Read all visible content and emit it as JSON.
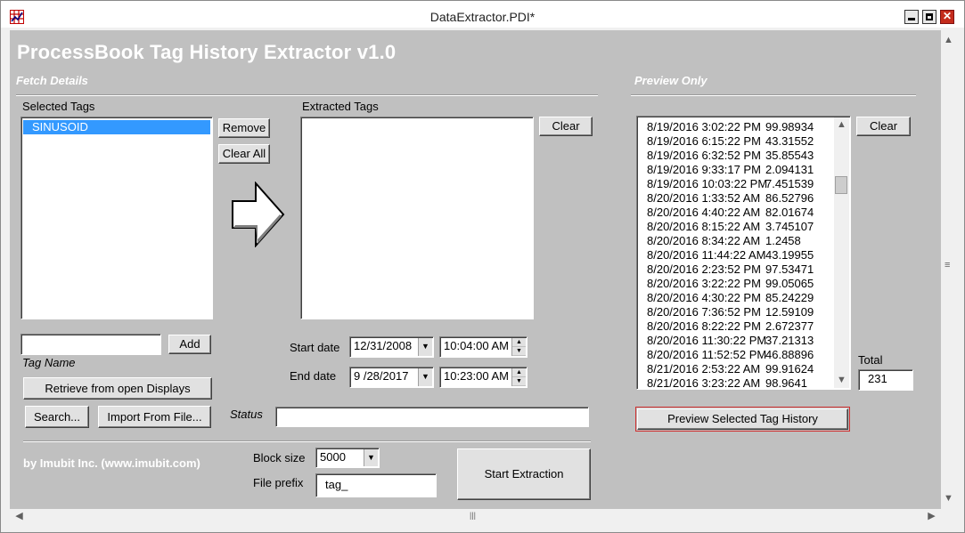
{
  "window": {
    "title": "DataExtractor.PDI*",
    "close_glyph": "✕"
  },
  "header": {
    "title": "ProcessBook Tag History Extractor v1.0"
  },
  "sections": {
    "fetch": "Fetch Details",
    "preview": "Preview Only"
  },
  "selected_tags": {
    "label": "Selected Tags",
    "items": [
      "SINUSOID"
    ],
    "remove_button": "Remove",
    "clear_all_button": "Clear All"
  },
  "extracted_tags": {
    "label": "Extracted Tags",
    "clear_button": "Clear"
  },
  "tag_input": {
    "value": "",
    "add_button": "Add",
    "label": "Tag Name"
  },
  "buttons": {
    "retrieve": "Retrieve from open Displays",
    "search": "Search...",
    "import": "Import From File...",
    "start": "Start Extraction",
    "preview": "Preview Selected Tag History",
    "preview_clear": "Clear"
  },
  "dates": {
    "start_label": "Start date",
    "start_date": "12/31/2008",
    "start_time": "10:04:00 AM",
    "end_label": "End date",
    "end_date": "9 /28/2017",
    "end_time": "10:23:00 AM"
  },
  "status": {
    "label": "Status",
    "value": ""
  },
  "footer": {
    "credit": "by Imubit Inc. (www.imubit.com)",
    "block_size_label": "Block size",
    "block_size": "5000",
    "file_prefix_label": "File prefix",
    "file_prefix": "tag_"
  },
  "preview": {
    "total_label": "Total",
    "total": "231",
    "rows": [
      [
        "8/19/2016 3:02:22 PM",
        "99.98934"
      ],
      [
        "8/19/2016 6:15:22 PM",
        "43.31552"
      ],
      [
        "8/19/2016 6:32:52 PM",
        "35.85543"
      ],
      [
        "8/19/2016 9:33:17 PM",
        "2.094131"
      ],
      [
        "8/19/2016 10:03:22 PM",
        "7.451539"
      ],
      [
        "8/20/2016 1:33:52 AM",
        "86.52796"
      ],
      [
        "8/20/2016 4:40:22 AM",
        "82.01674"
      ],
      [
        "8/20/2016 8:15:22 AM",
        "3.745107"
      ],
      [
        "8/20/2016 8:34:22 AM",
        "1.2458"
      ],
      [
        "8/20/2016 11:44:22 AM",
        "43.19955"
      ],
      [
        "8/20/2016 2:23:52 PM",
        "97.53471"
      ],
      [
        "8/20/2016 3:22:22 PM",
        "99.05065"
      ],
      [
        "8/20/2016 4:30:22 PM",
        "85.24229"
      ],
      [
        "8/20/2016 7:36:52 PM",
        "12.59109"
      ],
      [
        "8/20/2016 8:22:22 PM",
        "2.672377"
      ],
      [
        "8/20/2016 11:30:22 PM",
        "37.21313"
      ],
      [
        "8/20/2016 11:52:52 PM",
        "46.88896"
      ],
      [
        "8/21/2016 2:53:22 AM",
        "99.91624"
      ],
      [
        "8/21/2016 3:23:22 AM",
        "98.9641"
      ]
    ]
  },
  "icons": {
    "up": "▲",
    "down": "▼",
    "left": "◀",
    "right": "▶",
    "combo": "▼",
    "vgrip": "≡",
    "hgrip": "|||"
  }
}
